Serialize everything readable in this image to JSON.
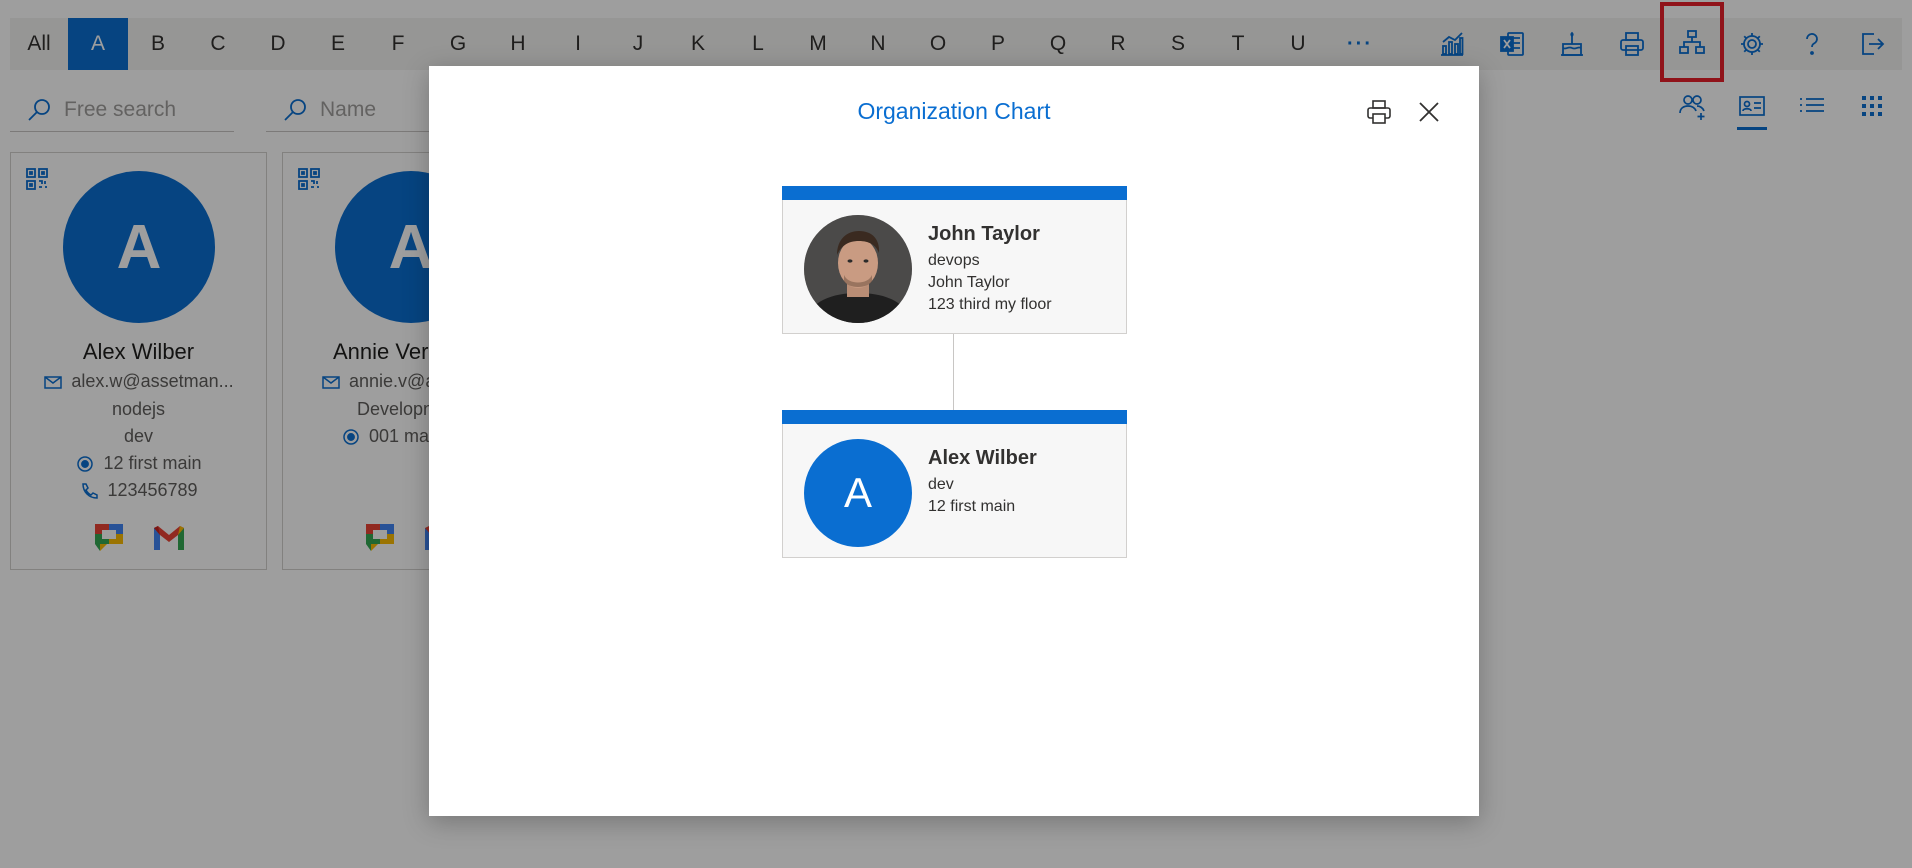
{
  "letter_bar": {
    "all_label": "All",
    "letters": [
      "A",
      "B",
      "C",
      "D",
      "E",
      "F",
      "G",
      "H",
      "I",
      "J",
      "K",
      "L",
      "M",
      "N",
      "O",
      "P",
      "Q",
      "R",
      "S",
      "T",
      "U"
    ],
    "active": "A",
    "more_label": "···"
  },
  "toolbar": {
    "icons": [
      "chart-icon",
      "excel-icon",
      "birthday-cake-icon",
      "print-icon",
      "org-chart-icon",
      "settings-icon",
      "help-icon",
      "signout-icon"
    ],
    "highlighted": "org-chart-icon",
    "accent": "#0a6ed1",
    "highlight_color": "#e8202b"
  },
  "search": {
    "free_placeholder": "Free search",
    "name_placeholder": "Name"
  },
  "view_tools": [
    "add-group-icon",
    "card-view-icon",
    "list-view-icon",
    "grid-view-icon"
  ],
  "cards": [
    {
      "initial": "A",
      "name": "Alex Wilber",
      "email": "alex.w@assetman...",
      "line1": "nodejs",
      "line2": "dev",
      "address": "12 first main",
      "phone": "123456789"
    },
    {
      "initial": "A",
      "name": "Annie Ver",
      "email": "annie.v@a",
      "line1": "Developn",
      "address": "001 mai"
    }
  ],
  "modal": {
    "title": "Organization Chart",
    "nodes": [
      {
        "name": "John Taylor",
        "line1": "devops",
        "line2": "John Taylor",
        "line3": "123 third my floor"
      },
      {
        "initial": "A",
        "name": "Alex Wilber",
        "line1": "dev",
        "line2": "12 first main"
      }
    ]
  }
}
